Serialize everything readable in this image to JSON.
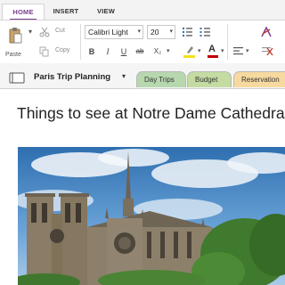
{
  "ribbon": {
    "tabs": [
      {
        "label": "HOME",
        "active": true
      },
      {
        "label": "INSERT",
        "active": false
      },
      {
        "label": "VIEW",
        "active": false
      }
    ],
    "clipboard": {
      "paste": "Paste",
      "cut": "Cut",
      "copy": "Copy"
    },
    "font": {
      "family": "Calibri Light",
      "size": "20"
    },
    "format_buttons": {
      "bold": "B",
      "italic": "I",
      "underline": "U",
      "strikethrough": "ab",
      "subscript": "X₂"
    },
    "highlight_color": "#f2e01b",
    "font_color": "#c00000"
  },
  "notebook": {
    "name": "Paris Trip Planning",
    "sections": [
      {
        "label": "Day Trips",
        "color": "#b7d8ae"
      },
      {
        "label": "Budget",
        "color": "#c4dba1"
      },
      {
        "label": "Reservation",
        "color": "#f7d9a0"
      }
    ]
  },
  "page": {
    "title": "Things to see at Notre Dame Cathedral"
  },
  "colors": {
    "accent": "#7b3f8f"
  }
}
